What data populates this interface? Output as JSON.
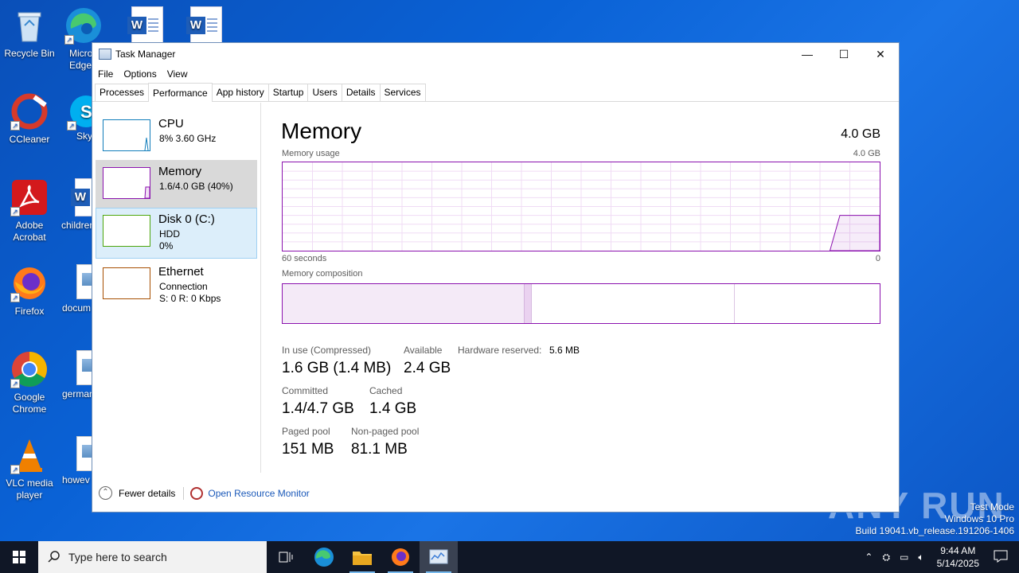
{
  "desktop": {
    "icons": [
      {
        "label": "Recycle Bin"
      },
      {
        "label": "Microsoft Edge"
      },
      {
        "label": "CCleaner"
      },
      {
        "label": "Skype"
      },
      {
        "label": "Adobe Acrobat"
      },
      {
        "label": "children"
      },
      {
        "label": "Firefox"
      },
      {
        "label": "docum"
      },
      {
        "label": "Google Chrome"
      },
      {
        "label": "german"
      },
      {
        "label": "VLC media player"
      },
      {
        "label": "howev"
      }
    ]
  },
  "window": {
    "title": "Task Manager",
    "menu": [
      "File",
      "Options",
      "View"
    ],
    "tabs": [
      "Processes",
      "Performance",
      "App history",
      "Startup",
      "Users",
      "Details",
      "Services"
    ],
    "active_tab": "Performance"
  },
  "sidebar": {
    "items": [
      {
        "name": "CPU",
        "line1": "8%  3.60 GHz",
        "line2": "",
        "color": "#117dbb"
      },
      {
        "name": "Memory",
        "line1": "1.6/4.0 GB (40%)",
        "line2": "",
        "color": "#8b12ae"
      },
      {
        "name": "Disk 0 (C:)",
        "line1": "HDD",
        "line2": "0%",
        "color": "#4da60c"
      },
      {
        "name": "Ethernet",
        "line1": "Connection",
        "line2": "S: 0  R: 0 Kbps",
        "color": "#a74f01"
      }
    ]
  },
  "memory": {
    "title": "Memory",
    "total": "4.0 GB",
    "usage_label": "Memory usage",
    "usage_max": "4.0 GB",
    "x_left": "60 seconds",
    "x_right": "0",
    "composition_label": "Memory composition",
    "history": [
      0,
      0,
      0,
      0,
      0,
      0,
      0,
      0,
      0,
      0,
      0,
      0,
      0,
      0,
      0,
      0,
      0,
      0,
      0,
      0,
      0,
      0,
      0,
      0,
      0,
      0,
      0,
      0,
      0,
      0,
      0,
      0,
      0,
      0,
      0,
      0,
      0,
      0,
      0,
      0,
      0,
      0,
      0,
      0,
      0,
      0,
      0,
      0,
      0,
      0,
      0,
      0,
      0,
      0,
      0,
      0,
      0.4,
      0.4,
      0.4,
      0.4,
      0.4
    ],
    "composition": {
      "in_use": 0.405,
      "modified": 0.012,
      "standby": 0.34,
      "free": 0.243
    },
    "stats": {
      "in_use_label": "In use (Compressed)",
      "in_use_value": "1.6 GB (1.4 MB)",
      "available_label": "Available",
      "available_value": "2.4 GB",
      "hw_reserved_label": "Hardware reserved:",
      "hw_reserved_value": "5.6 MB",
      "committed_label": "Committed",
      "committed_value": "1.4/4.7 GB",
      "cached_label": "Cached",
      "cached_value": "1.4 GB",
      "paged_label": "Paged pool",
      "paged_value": "151 MB",
      "nonpaged_label": "Non-paged pool",
      "nonpaged_value": "81.1 MB"
    }
  },
  "footer": {
    "fewer_details": "Fewer details",
    "resource_monitor": "Open Resource Monitor"
  },
  "watermark": {
    "brand": "ANY RUN",
    "line1": "Test Mode",
    "line2": "Windows 10 Pro",
    "line3": "Build 19041.vb_release.191206-1406"
  },
  "taskbar": {
    "search_placeholder": "Type here to search",
    "time": "9:44 AM",
    "date": "5/14/2025"
  }
}
